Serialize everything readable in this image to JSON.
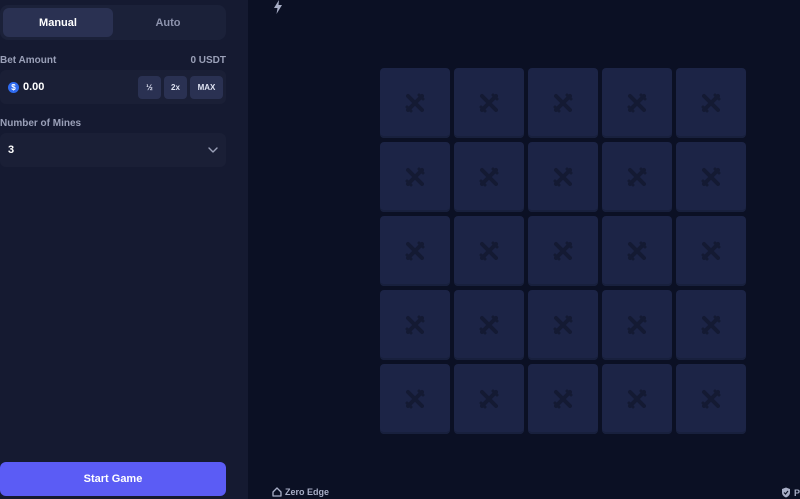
{
  "mode_tabs": [
    {
      "label": "Manual",
      "active": true
    },
    {
      "label": "Auto",
      "active": false
    }
  ],
  "bet": {
    "label": "Bet Amount",
    "balance": "0 USDT",
    "coin_symbol": "$",
    "value": "0.00",
    "half_label": "½",
    "double_label": "2x",
    "max_label": "MAX"
  },
  "mines": {
    "label": "Number of Mines",
    "value": "3"
  },
  "start_label": "Start Game",
  "footer": {
    "zero_edge_label": "Zero Edge",
    "right_label": "P"
  },
  "grid": {
    "rows": 5,
    "cols": 5,
    "tile_icon": "crossed-swords-icon"
  },
  "colors": {
    "accent": "#5b5cf5",
    "tile": "#1c2446",
    "background": "#0b1024",
    "panel": "#151a31"
  }
}
